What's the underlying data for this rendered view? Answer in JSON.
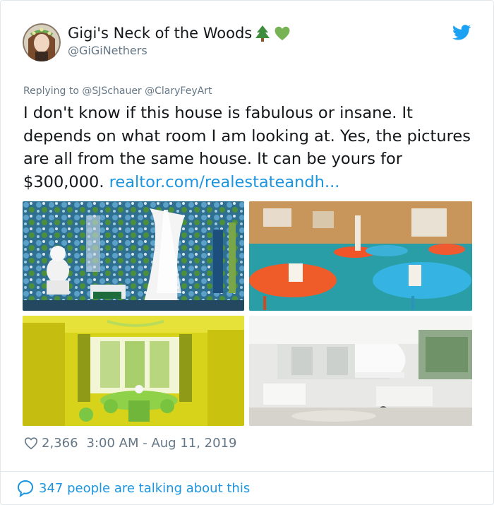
{
  "user": {
    "display_name": "Gigi's Neck of the Woods",
    "handle": "@GiGiNethers",
    "name_emojis": [
      "tree-emoji",
      "green-heart-emoji"
    ]
  },
  "reply": {
    "prefix": "Replying to",
    "mentions": "@SJSchauer @ClaryFeyArt"
  },
  "tweet": {
    "text": "I don't know if this house is fabulous or insane. It depends on what room I am looking at. Yes, the pictures are all from the same house. It can be yours for $300,000.",
    "link": "realtor.com/realestateandh..."
  },
  "stats": {
    "likes": "2,366",
    "time": "3:00 AM - Aug 11, 2019"
  },
  "footer": {
    "talking": "347 people are talking about this"
  },
  "colors": {
    "link": "#1b95e0",
    "secondary": "#657786",
    "twitter_blue": "#1da1f2"
  },
  "photos": [
    {
      "subject": "blue floral wallpaper room with white bust statue"
    },
    {
      "subject": "room with orange and turquoise round tables"
    },
    {
      "subject": "yellow dining room with green table"
    },
    {
      "subject": "white living room with grand piano"
    }
  ]
}
